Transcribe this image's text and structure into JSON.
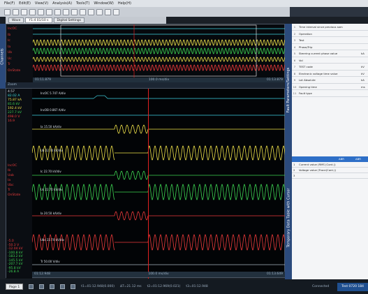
{
  "colors": {
    "trace_cyan": "#3fd0e0",
    "trace_yellow": "#f1e34a",
    "trace_green": "#3ed653",
    "trace_red": "#ee3b3b",
    "cursor": "#e02020",
    "panel_blue": "#2b4a7c"
  },
  "overview": {
    "channel_labels": [
      "IncOC",
      "Ib",
      "Ic",
      "Ia",
      "Ub",
      "Uc",
      "Tr",
      "OnState"
    ],
    "time_start": "01:11.879",
    "time_end": "01:13.879",
    "scale": "100.0 ms/div"
  },
  "detail": {
    "header_label": "Zoom",
    "values_top": [
      "4.57",
      "82.02 A",
      "75.87 kA",
      "81.6 kV",
      "192.4 kV",
      "227.7 kV",
      "498.0 V",
      "16.9"
    ],
    "channel_labels": [
      "IncOC",
      "Ib",
      "Uab",
      "Ia",
      "Ubc",
      "Tr",
      "OnState"
    ],
    "values_bottom": [
      "-5.0",
      "-50.3 V",
      "-12.04 kV",
      "-100.8 kV",
      "-183.2 kV",
      "-145.5 kV",
      "-207.7 kV",
      "-95.8 kV",
      "-26.8 A"
    ],
    "trace_labels": [
      "IncOC 5.747 A/div",
      "IncOB 0.867 A/div",
      "Ia 15.50 kA/div",
      "Ub 22.70 kV/div",
      "Ic 22.70 kV/div",
      "Uc 22.70 kV/div",
      "Ia 20.50 kA/div",
      "Ubc 22.70 kV/div",
      "Tr 50.00 V/div"
    ],
    "time_start": "01:12.948",
    "time_end": "01:13.649",
    "scale": "100.0 ms/div"
  },
  "right_panel": {
    "title": "Fault Parameters/Settings",
    "rows": [
      {
        "n": "1",
        "name": "Time interval since previous sam",
        "val": "",
        "unit": ""
      },
      {
        "n": "2",
        "name": "Operation",
        "val": "",
        "unit": ""
      },
      {
        "n": "3",
        "name": "Test",
        "val": "",
        "unit": ""
      },
      {
        "n": "4",
        "name": "Phase/Trip",
        "val": "",
        "unit": ""
      },
      {
        "n": "5",
        "name": "Steering current phase value",
        "val": "",
        "unit": "kA"
      },
      {
        "n": "6",
        "name": "Vol",
        "val": "",
        "unit": ""
      },
      {
        "n": "7",
        "name": "TEST code",
        "val": "",
        "unit": "kV"
      },
      {
        "n": "8",
        "name": "Electronic voltage time value",
        "val": "",
        "unit": "kV"
      },
      {
        "n": "9",
        "name": "Lot Absolute",
        "val": "",
        "unit": "kA"
      },
      {
        "n": "10",
        "name": "Opening time",
        "val": "",
        "unit": "ms"
      },
      {
        "n": "11",
        "name": "Fault type",
        "val": "",
        "unit": ""
      }
    ]
  },
  "right_panel2": {
    "title": "Temporary Data Table with Cursor",
    "head": [
      "",
      "",
      "ABR",
      "ABR"
    ],
    "rows": [
      {
        "n": "1",
        "name": "Current value (RMS (Cont.))",
        "a": "",
        "b": ""
      },
      {
        "n": "2",
        "name": "Voltage value (Trace(Cont.))",
        "a": "",
        "b": ""
      },
      {
        "n": "3",
        "name": "",
        "a": "",
        "b": ""
      }
    ]
  },
  "menubar": [
    "File(F)",
    "Edit(E)",
    "View(V)",
    "Analysis(A)",
    "Tools(T)",
    "Window(W)",
    "Help(H)"
  ],
  "tabs": [
    "Wave",
    "Y1:4 01/10 s",
    "Digital Settings"
  ],
  "bottom": {
    "page": "Page 1",
    "cursor_t1": "t1=01:12.948(0.000)",
    "delta": "ΔT=21.12 ms",
    "cursor_t2": "t2=01:12.969(0.021)",
    "extra": "t3=01:12.948",
    "status": "Connected",
    "button": "Test 0720 184"
  }
}
